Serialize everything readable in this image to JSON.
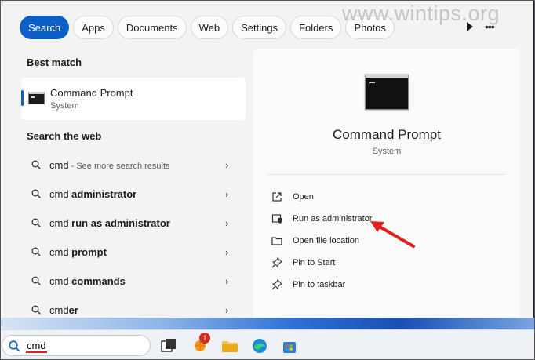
{
  "watermark": "www.wintips.org",
  "tabs": [
    {
      "label": "Search",
      "active": true
    },
    {
      "label": "Apps"
    },
    {
      "label": "Documents"
    },
    {
      "label": "Web"
    },
    {
      "label": "Settings"
    },
    {
      "label": "Folders"
    },
    {
      "label": "Photos"
    }
  ],
  "icons": {
    "play": "play-icon",
    "more": "more-icon",
    "search": "search-icon"
  },
  "left": {
    "best_match_title": "Best match",
    "best_match": {
      "name": "Command Prompt",
      "type": "System",
      "icon": "command-prompt-icon"
    },
    "web_title": "Search the web",
    "web_results": [
      {
        "prefix": "cmd",
        "bold": "",
        "hint": " - See more search results"
      },
      {
        "prefix": "cmd ",
        "bold": "administrator",
        "hint": ""
      },
      {
        "prefix": "cmd ",
        "bold": "run as administrator",
        "hint": ""
      },
      {
        "prefix": "cmd ",
        "bold": "prompt",
        "hint": ""
      },
      {
        "prefix": "cmd ",
        "bold": "commands",
        "hint": ""
      },
      {
        "prefix": "cmd",
        "bold": "er",
        "hint": ""
      }
    ]
  },
  "detail": {
    "name": "Command Prompt",
    "type": "System",
    "actions": [
      {
        "label": "Open",
        "icon": "open-icon"
      },
      {
        "label": "Run as administrator",
        "icon": "shield-icon"
      },
      {
        "label": "Open file location",
        "icon": "folder-icon"
      },
      {
        "label": "Pin to Start",
        "icon": "pin-icon"
      },
      {
        "label": "Pin to taskbar",
        "icon": "pin-icon"
      }
    ]
  },
  "taskbar": {
    "search_value": "cmd",
    "notification_count": "1",
    "apps": [
      "task-view-icon",
      "widgets-icon",
      "file-explorer-icon",
      "edge-icon",
      "store-icon"
    ]
  },
  "colors": {
    "accent": "#0b5fc7",
    "arrow": "#e02020"
  }
}
